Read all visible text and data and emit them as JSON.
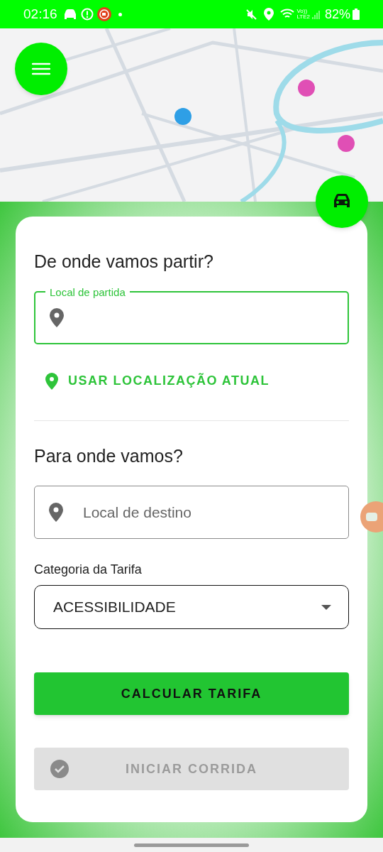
{
  "status_bar": {
    "time": "02:16",
    "network_top": "Vo))",
    "network_bottom": "LTE2",
    "battery": "82%"
  },
  "origin": {
    "title": "De onde vamos partir?",
    "label": "Local de partida",
    "focused": true
  },
  "use_location": {
    "label": "USAR LOCALIZAÇÃO ATUAL"
  },
  "destination": {
    "title": "Para onde vamos?",
    "placeholder": "Local de destino",
    "focused": false
  },
  "fare": {
    "label": "Categoria da Tarifa",
    "value": "ACESSIBILIDADE"
  },
  "buttons": [
    {
      "kind": "calculate",
      "label": "CALCULAR TARIFA",
      "disabled": false
    },
    {
      "kind": "start",
      "label": "INICIAR CORRIDA",
      "disabled": true
    }
  ]
}
